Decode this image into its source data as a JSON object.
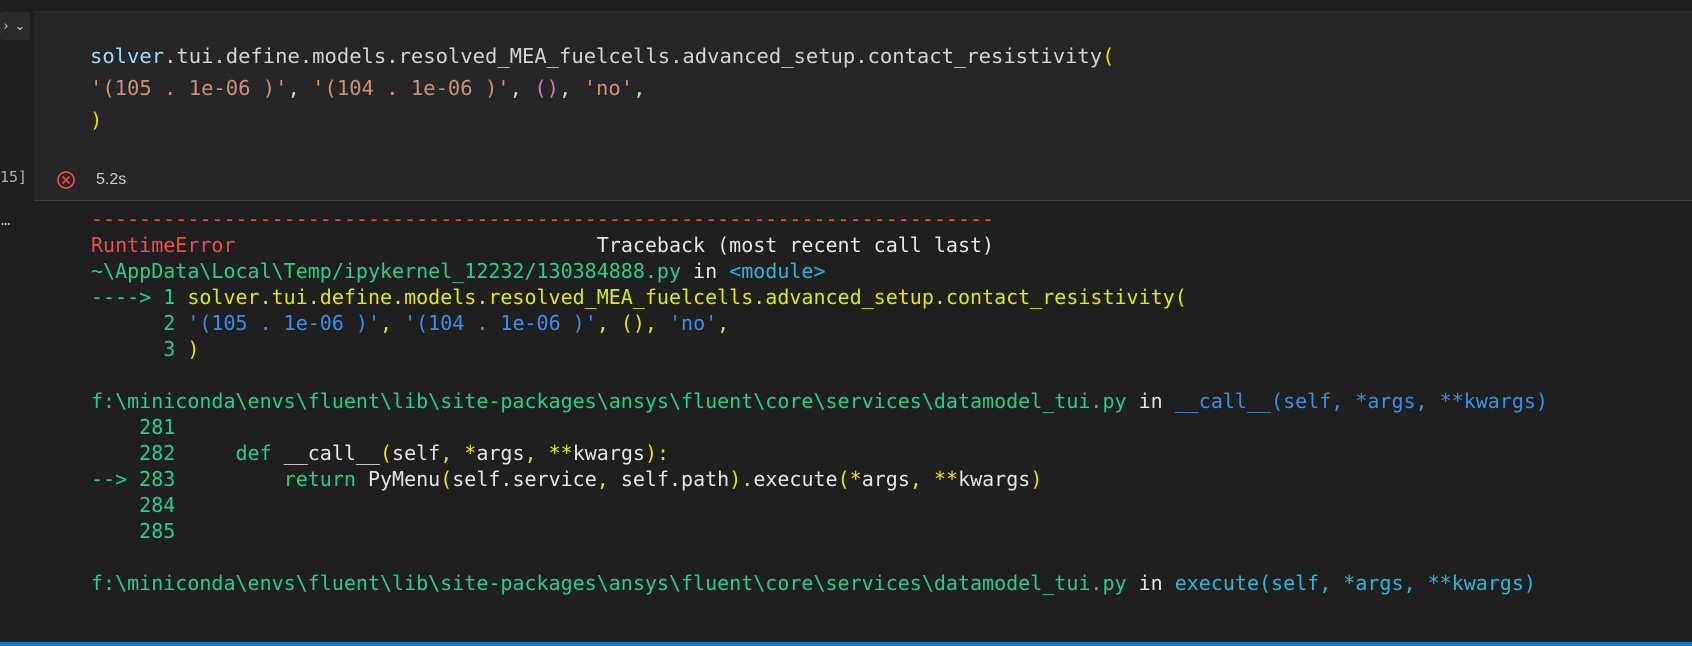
{
  "cell": {
    "toggle_icon": "chevron-right-icon",
    "toggle_icon2": "chevron-down-icon",
    "execution_count": "15]",
    "duration": "5.2s",
    "status_icon": "error-circle-icon",
    "code": {
      "line1_obj": "solver",
      "line1_rest": ".tui.define.models.resolved_MEA_fuelcells.advanced_setup.contact_resistivity",
      "line1_paren": "(",
      "line2_str1": "'(105 . 1e-06 )'",
      "line2_sep1": ", ",
      "line2_str2": "'(104 . 1e-06 )'",
      "line2_sep2": ", ",
      "line2_tuple": "()",
      "line2_sep3": ", ",
      "line2_str3": "'no'",
      "line2_end": ",",
      "line3_paren": ")"
    }
  },
  "output": {
    "more_indicator": "...",
    "dashes": "---------------------------------------------------------------------------",
    "error_name": "RuntimeError",
    "traceback_header": "                              Traceback (most recent call last)",
    "frame1": {
      "file": "~\\AppData\\Local\\Temp/ipykernel_12232/130384888.py",
      "in": " in ",
      "func": "<module>",
      "arrow_line_prefix": "----> 1 ",
      "arrow_line_code": "solver.tui.define.models.resolved_MEA_fuelcells.advanced_setup.contact_resistivity(",
      "l2_num": "      2 ",
      "l2_str1": "'(105 . 1e-06 )'",
      "l2_sep1": ", ",
      "l2_str2": "'(104 . 1e-06 )'",
      "l2_sep2": ", (), ",
      "l2_str3": "'no'",
      "l2_end": ",",
      "l3_num": "      3 ",
      "l3_code": ")"
    },
    "frame2": {
      "file": "f:\\miniconda\\envs\\fluent\\lib\\site-packages\\ansys\\fluent\\core\\services\\datamodel_tui.py",
      "in": " in ",
      "func": "__call__(self, *args, **kwargs)",
      "l281": "    281",
      "l282_num": "    282 ",
      "l282_kw": "    def ",
      "l282_name": "__call__",
      "l282_p1": "(",
      "l282_args": "self",
      "l282_c1": ", ",
      "l282_star1": "*",
      "l282_a2": "args",
      "l282_c2": ", ",
      "l282_star2": "**",
      "l282_a3": "kwargs",
      "l282_p2": "):",
      "l283_prefix": "--> 283 ",
      "l283_kw": "        return ",
      "l283_call": "PyMenu",
      "l283_p1": "(",
      "l283_a1": "self.service",
      "l283_c1": ", ",
      "l283_a2": "self.path",
      "l283_p2": ").",
      "l283_m": "execute",
      "l283_p3": "(",
      "l283_s1": "*",
      "l283_b1": "args",
      "l283_c2": ", ",
      "l283_s2": "**",
      "l283_b2": "kwargs",
      "l283_p4": ")",
      "l284": "    284",
      "l285": "    285"
    },
    "frame3": {
      "file": "f:\\miniconda\\envs\\fluent\\lib\\site-packages\\ansys\\fluent\\core\\services\\datamodel_tui.py",
      "in": " in ",
      "func": "execute(self, *args, **kwargs)"
    }
  },
  "colors": {
    "background": "#1f1f1f",
    "cell_background": "#262626",
    "error_red": "#f14c4c",
    "accent_blue": "#0e7fd1"
  }
}
